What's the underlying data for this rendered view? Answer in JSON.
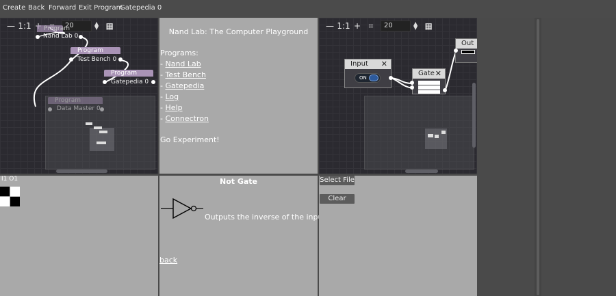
{
  "menu": {
    "items": [
      {
        "label": "Create"
      },
      {
        "label": "Back"
      },
      {
        "label": "Forward"
      },
      {
        "label": "Exit Program"
      },
      {
        "label": "Gatepedia 0"
      }
    ]
  },
  "left_graph": {
    "zoom_label": "1:1",
    "zoom_value": "20",
    "nodes": [
      {
        "title": "Program",
        "label": "Nand Lab 0"
      },
      {
        "title": "Program",
        "label": "Test Bench 0"
      },
      {
        "title": "Program",
        "label": "Gatepedia 0"
      },
      {
        "title": "Program",
        "label": "Data Master 0"
      }
    ]
  },
  "doc": {
    "title": "Nand Lab: The Computer Playground",
    "programs_heading": "Programs:",
    "bullet": "- ",
    "links": [
      "Nand Lab",
      "Test Bench",
      "Gatepedia",
      "Log",
      "Help",
      "Connectron"
    ],
    "footer": "Go Experiment!"
  },
  "right_graph": {
    "zoom_label": "1:1",
    "zoom_value": "20",
    "input_node": {
      "title": "Input",
      "close": "✕",
      "toggle_text": "ON"
    },
    "gate_node": {
      "title": "Gate",
      "close": "✕"
    },
    "output_node": {
      "title": "Out"
    }
  },
  "truth_table": {
    "header": "I1  O1",
    "rows": [
      [
        "black",
        "white"
      ],
      [
        "white",
        "black"
      ]
    ]
  },
  "gate_info": {
    "title": "Not Gate",
    "description": "Outputs the inverse of the input.",
    "back_link": "back"
  },
  "file_panel": {
    "select_file": "Select File",
    "clear": "Clear"
  },
  "colors": {
    "node_title": "#a993b6",
    "panel_grey": "#a9a9a9",
    "graph_bg": "#2b2a30",
    "toggle_knob": "#2d5a9c"
  }
}
